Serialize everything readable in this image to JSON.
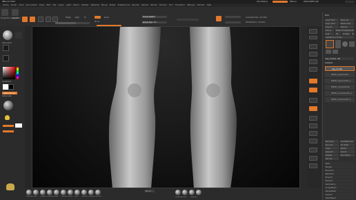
{
  "app": {
    "title": "ZBrush 2021",
    "quicksave": "QuickSave",
    "see_through": "See-through 0",
    "menus_label": "Menus",
    "default_script": "DefaultZScript"
  },
  "menubar": [
    "Alpha",
    "Brush",
    "Color",
    "Document",
    "Draw",
    "Edit",
    "File",
    "Layer",
    "Light",
    "Macro",
    "Marker",
    "Material",
    "Movie",
    "Picker",
    "Preferences",
    "Render",
    "Stencil",
    "Stroke",
    "Texture",
    "Tool",
    "Transform",
    "ZPlugin",
    "ZScript",
    "Help"
  ],
  "toolbar": {
    "projection": "Projection Master",
    "lightbox": "LightBox",
    "edit": "Edit",
    "draw": "Draw",
    "move": "Move",
    "scale": "Scale",
    "rotate": "Rotate",
    "mrgb": "Mrgb",
    "rgb": "Rgb",
    "m": "M",
    "zadd": "Zadd",
    "zsub": "Zsub",
    "zcut": "Zcut",
    "rgb_intensity": "Rgb Intensity",
    "z_intensity": "Z Intensity 25",
    "focal_shift": "Focal Shift 0",
    "draw_size": "Draw Size 64",
    "dynamic": "Dynamic",
    "active_points": "ActivePoints: 44,392",
    "total_points": "TotalPoints: 44,392"
  },
  "left": {
    "brush_label": "Standard",
    "stroke_label": "Dots",
    "alpha_label": "Alpha Off",
    "texture_label": "Texture Off",
    "gradient": "Gradient",
    "switch_color": "SwitchColor",
    "alternate": "Alternate",
    "material_label": "MatCap Gray"
  },
  "right": {
    "panel_title": "Tool",
    "items": [
      "Load Tool",
      "Save As",
      "Copy Tool",
      "Paste Tool",
      "Import",
      "Export",
      "Clone",
      "Make PolyMesh3D",
      "GoZ",
      "All",
      "Visible",
      "R",
      "Lightbox ▸ Tools"
    ],
    "tool_name": "leg_model. 48",
    "subtool_header": "Subtool",
    "subtools": [
      "leg_model",
      "PM3D_Sphere3D",
      "PM3D_Sphere3D_1",
      "PM3D_Cylinder3D",
      "PM3D_Cylinder3D_1",
      "PM3D_Sphere3D_2"
    ],
    "buttons": [
      "Rename",
      "AutoReorder",
      "All Low",
      "All High",
      "Copy",
      "Paste",
      "Append",
      "Insert",
      "Delete",
      "Del Other",
      "Del All",
      "Split",
      "Merge",
      "Boolean",
      "Remesh",
      "Project",
      "Extract",
      "Geometry",
      "ArrayMesh",
      "NanoMesh",
      "Layers",
      "FiberMesh"
    ]
  },
  "bottom": {
    "brushes": [
      "Standard",
      "Move",
      "ClayBuildup",
      "DamStandard",
      "Inflate",
      "TrimDynamic",
      "hPolish",
      "Pinch",
      "SnakeHook",
      "ZModeler",
      "IMM Primitives"
    ],
    "center_label": "Mirror",
    "mirror_label": "Mirror And Weld",
    "dynamesh": "DynaMesh"
  },
  "colors": {
    "accent": "#e3782b",
    "bg": "#2a2a2a",
    "canvas": "#1a1a1a"
  }
}
